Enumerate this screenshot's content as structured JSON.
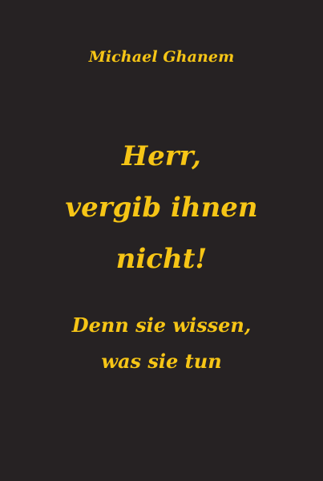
{
  "cover": {
    "background_color": "#262223",
    "text_color": "#f6c516",
    "author": "Michael Ghanem",
    "title_lines": [
      "Herr,",
      "vergib ihnen",
      "nicht!"
    ],
    "subtitle_lines": [
      "Denn sie wissen,",
      "was sie tun"
    ]
  }
}
